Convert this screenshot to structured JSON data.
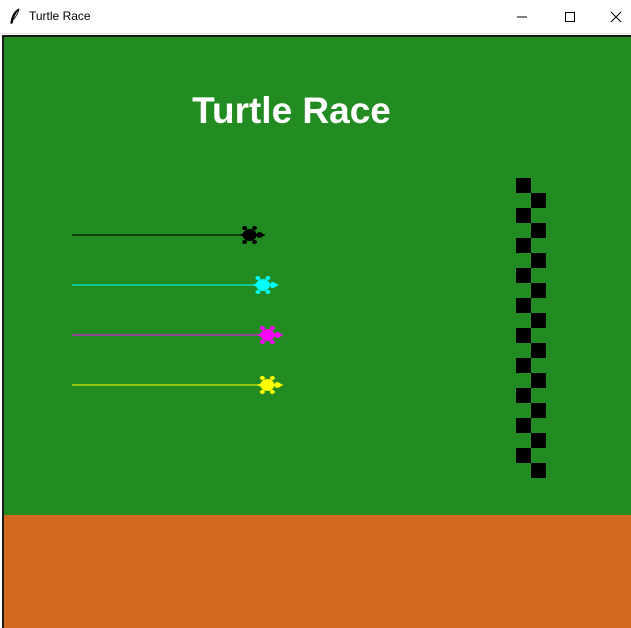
{
  "window": {
    "title": "Turtle Race",
    "app_icon": "feather-icon",
    "controls": [
      "minimize-icon",
      "maximize-icon",
      "close-icon"
    ]
  },
  "scene": {
    "title": "Turtle Race",
    "title_color": "#ffffff",
    "grass_color": "#228b22",
    "dirt_color": "#d2691e",
    "finish_line_color": "#000000",
    "turtles": [
      {
        "color": "#000000",
        "name": "black",
        "progress": 0.4
      },
      {
        "color": "#00ffff",
        "name": "cyan",
        "progress": 0.43
      },
      {
        "color": "#ff00ff",
        "name": "magenta",
        "progress": 0.44
      },
      {
        "color": "#ffff00",
        "name": "yellow",
        "progress": 0.44
      }
    ]
  }
}
